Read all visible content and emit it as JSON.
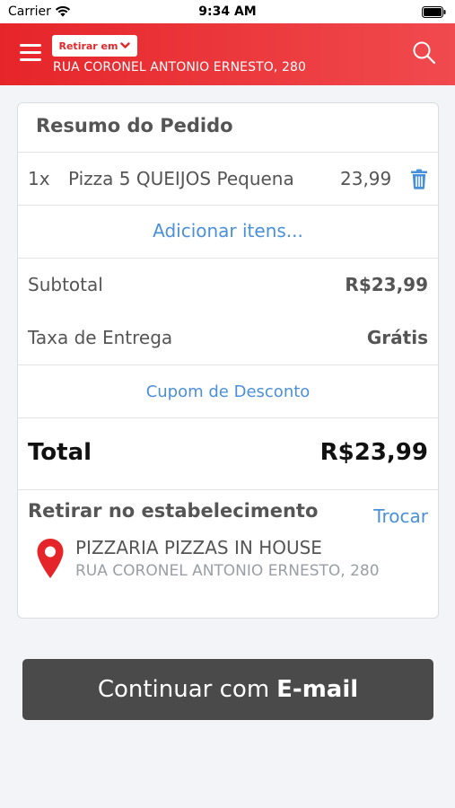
{
  "status_bar": {
    "carrier": "Carrier",
    "time": "9:34 AM"
  },
  "header": {
    "pickup_label": "Retirar em",
    "address": "RUA CORONEL ANTONIO ERNESTO, 280",
    "icons": [
      "menu-icon",
      "chevron-down-icon",
      "search-icon"
    ],
    "color": "#e6252a"
  },
  "summary": {
    "title": "Resumo do Pedido",
    "items": [
      {
        "qty": "1x",
        "name": "Pizza 5 QUEIJOS Pequena",
        "price": "23,99"
      }
    ],
    "add_items": "Adicionar itens...",
    "subtotal_label": "Subtotal",
    "subtotal_value": "R$23,99",
    "delivery_label": "Taxa de Entrega",
    "delivery_value": "Grátis",
    "coupon": "Cupom de Desconto",
    "total_label": "Total",
    "total_value": "R$23,99"
  },
  "pickup": {
    "title": "Retirar no estabelecimento",
    "change": "Trocar",
    "store_name": "PIZZARIA PIZZAS IN HOUSE",
    "store_address": "RUA CORONEL ANTONIO ERNESTO, 280"
  },
  "cta": {
    "prefix": "Continuar com",
    "bold": "E-mail"
  },
  "colors": {
    "accent_red": "#e6252a",
    "link_blue": "#4a90d9",
    "button_dark": "#4a4a4a"
  }
}
